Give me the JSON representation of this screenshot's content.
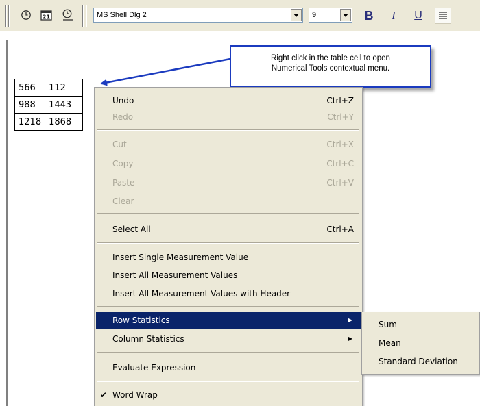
{
  "toolbar": {
    "icons": [
      "clock-icon",
      "calendar-icon",
      "clock-insert-icon"
    ],
    "font_name": "MS Shell Dlg 2",
    "font_size": "9",
    "bold_label": "B",
    "italic_label": "I",
    "underline_label": "U",
    "align_icon": "align-left-icon"
  },
  "table": {
    "rows": [
      [
        "566",
        "112"
      ],
      [
        "988",
        "1443"
      ],
      [
        "1218",
        "1868"
      ]
    ]
  },
  "callout": {
    "line1": "Right click in the table cell to open",
    "line2": "Numerical Tools contextual menu."
  },
  "menu": {
    "undo": {
      "label": "Undo",
      "shortcut": "Ctrl+Z"
    },
    "redo": {
      "label": "Redo",
      "shortcut": "Ctrl+Y"
    },
    "cut": {
      "label": "Cut",
      "shortcut": "Ctrl+X"
    },
    "copy": {
      "label": "Copy",
      "shortcut": "Ctrl+C"
    },
    "paste": {
      "label": "Paste",
      "shortcut": "Ctrl+V"
    },
    "clear": {
      "label": "Clear"
    },
    "select_all": {
      "label": "Select All",
      "shortcut": "Ctrl+A"
    },
    "insert_single": {
      "label": "Insert Single Measurement Value"
    },
    "insert_all": {
      "label": "Insert All Measurement Values"
    },
    "insert_all_header": {
      "label": "Insert All Measurement Values with Header"
    },
    "row_stats": {
      "label": "Row Statistics",
      "arrow": "▶"
    },
    "col_stats": {
      "label": "Column Statistics",
      "arrow": "▶"
    },
    "evaluate": {
      "label": "Evaluate Expression"
    },
    "word_wrap": {
      "label": "Word Wrap",
      "check": "✔"
    }
  },
  "submenu": {
    "items": [
      "Sum",
      "Mean",
      "Standard Deviation"
    ]
  },
  "colors": {
    "highlight": "#0a246a",
    "callout_border": "#1b3bbf",
    "menu_bg": "#ece9d8"
  }
}
